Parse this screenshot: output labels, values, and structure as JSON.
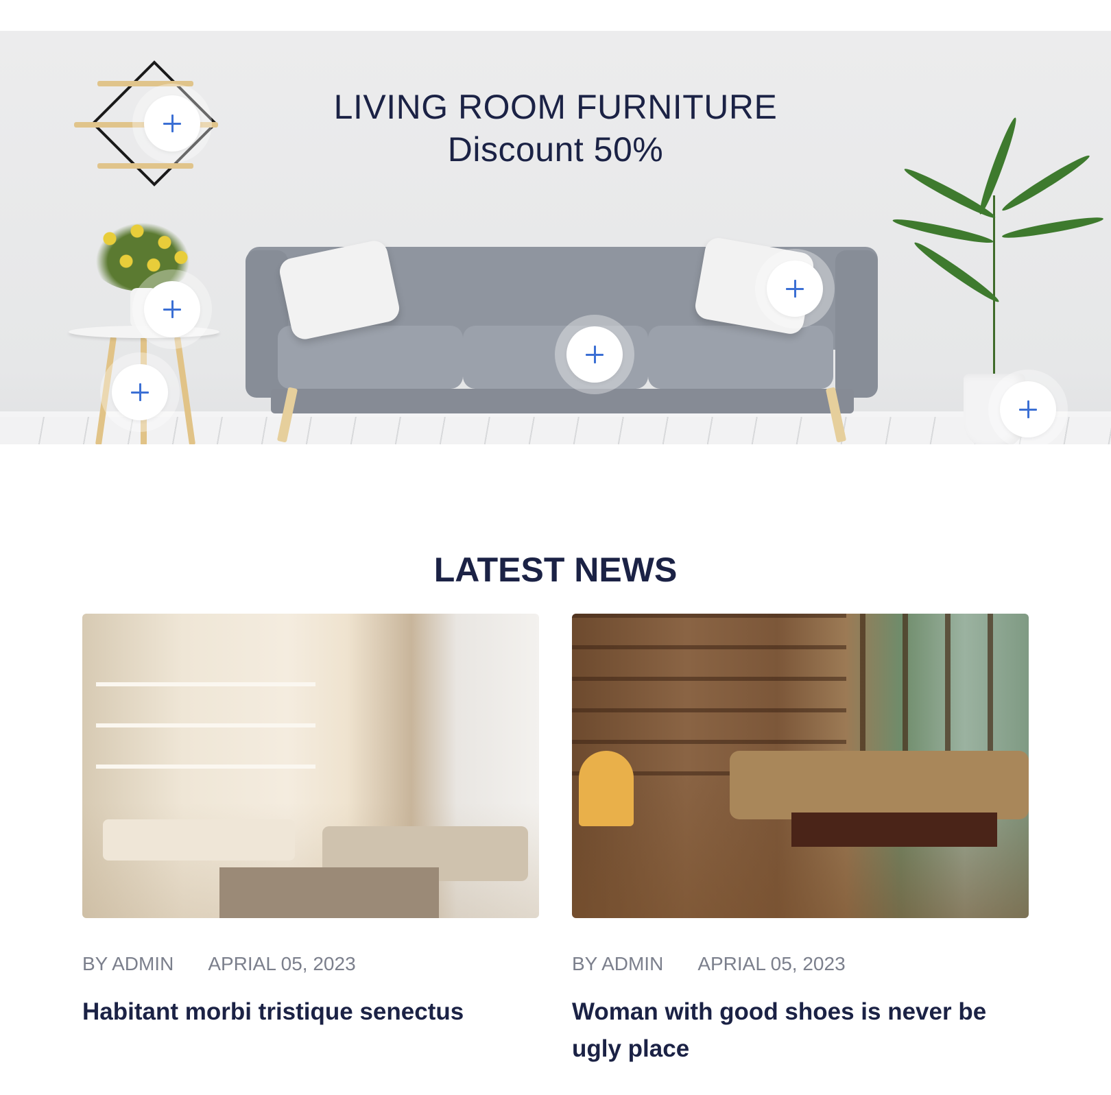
{
  "hero": {
    "title_line1": "LIVING ROOM FURNITURE",
    "title_line2": "Discount 50%",
    "hotspot_icon": "plus-icon",
    "accent_color": "#3b6fd4"
  },
  "news": {
    "section_title": "LATEST NEWS",
    "articles": [
      {
        "author": "BY ADMIN",
        "date": "APRIAL 05, 2023",
        "title": "Habitant morbi tristique senectus"
      },
      {
        "author": "BY ADMIN",
        "date": "APRIAL 05, 2023",
        "title": "Woman with good shoes is never be ugly place"
      }
    ]
  },
  "colors": {
    "heading": "#1b2245",
    "meta": "#7b7f8c",
    "hotspot_plus": "#3b6fd4"
  }
}
